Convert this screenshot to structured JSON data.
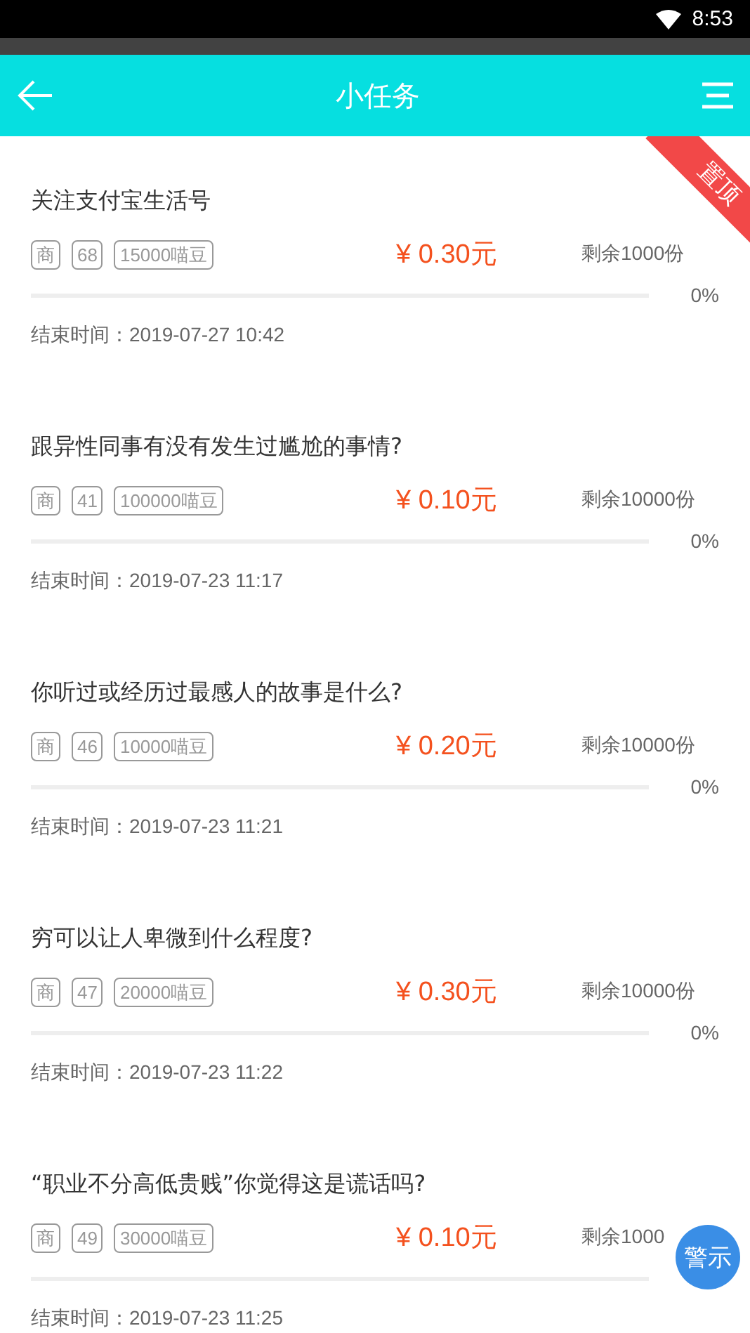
{
  "status_bar": {
    "time": "8:53"
  },
  "header": {
    "title": "小任务"
  },
  "tasks": [
    {
      "title": "关注支付宝生活号",
      "pinned": true,
      "pin_label": "置顶",
      "tags": [
        "商",
        "68",
        "15000喵豆"
      ],
      "price": "¥ 0.30元",
      "remaining": "剩余1000份",
      "level": 0,
      "percent": "0%",
      "end_time": "结束时间：2019-07-27 10:42"
    },
    {
      "title": "跟异性同事有没有发生过尴尬的事情?",
      "pinned": false,
      "tags": [
        "商",
        "41",
        "100000喵豆"
      ],
      "price": "¥ 0.10元",
      "remaining": "剩余10000份",
      "level": 0,
      "percent": "0%",
      "end_time": "结束时间：2019-07-23 11:17"
    },
    {
      "title": "你听过或经历过最感人的故事是什么?",
      "pinned": false,
      "tags": [
        "商",
        "46",
        "10000喵豆"
      ],
      "price": "¥ 0.20元",
      "remaining": "剩余10000份",
      "level": 0,
      "percent": "0%",
      "end_time": "结束时间：2019-07-23 11:21"
    },
    {
      "title": "穷可以让人卑微到什么程度?",
      "pinned": false,
      "tags": [
        "商",
        "47",
        "20000喵豆"
      ],
      "price": "¥ 0.30元",
      "remaining": "剩余10000份",
      "level": 0,
      "percent": "0%",
      "end_time": "结束时间：2019-07-23 11:22"
    },
    {
      "title": "“职业不分高低贵贱”你觉得这是谎话吗?",
      "pinned": false,
      "tags": [
        "商",
        "49",
        "30000喵豆"
      ],
      "price": "¥ 0.10元",
      "remaining": "剩余1000",
      "level": 0,
      "end_time": "结束时间：2019-07-23 11:25"
    }
  ],
  "float_button": {
    "label": "警示"
  }
}
